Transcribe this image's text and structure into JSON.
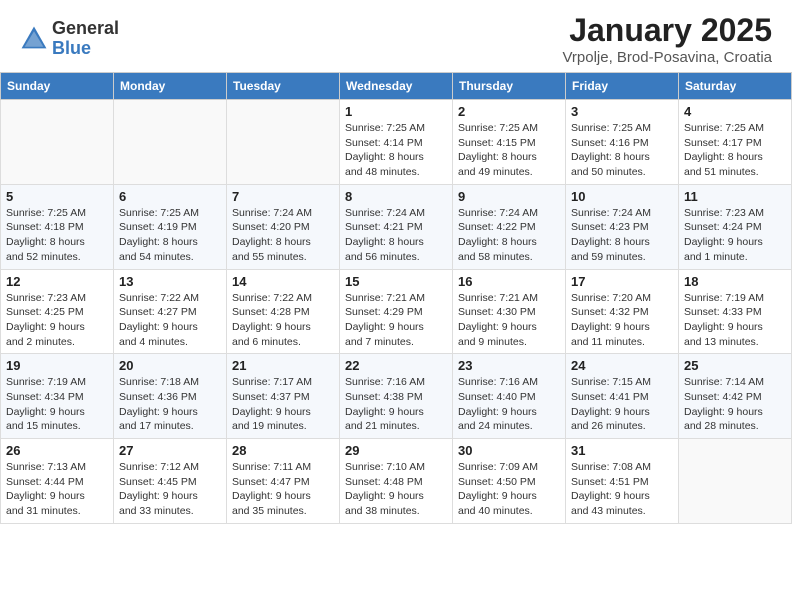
{
  "header": {
    "logo_general": "General",
    "logo_blue": "Blue",
    "month": "January 2025",
    "location": "Vrpolje, Brod-Posavina, Croatia"
  },
  "weekdays": [
    "Sunday",
    "Monday",
    "Tuesday",
    "Wednesday",
    "Thursday",
    "Friday",
    "Saturday"
  ],
  "weeks": [
    [
      {
        "day": "",
        "info": ""
      },
      {
        "day": "",
        "info": ""
      },
      {
        "day": "",
        "info": ""
      },
      {
        "day": "1",
        "info": "Sunrise: 7:25 AM\nSunset: 4:14 PM\nDaylight: 8 hours\nand 48 minutes."
      },
      {
        "day": "2",
        "info": "Sunrise: 7:25 AM\nSunset: 4:15 PM\nDaylight: 8 hours\nand 49 minutes."
      },
      {
        "day": "3",
        "info": "Sunrise: 7:25 AM\nSunset: 4:16 PM\nDaylight: 8 hours\nand 50 minutes."
      },
      {
        "day": "4",
        "info": "Sunrise: 7:25 AM\nSunset: 4:17 PM\nDaylight: 8 hours\nand 51 minutes."
      }
    ],
    [
      {
        "day": "5",
        "info": "Sunrise: 7:25 AM\nSunset: 4:18 PM\nDaylight: 8 hours\nand 52 minutes."
      },
      {
        "day": "6",
        "info": "Sunrise: 7:25 AM\nSunset: 4:19 PM\nDaylight: 8 hours\nand 54 minutes."
      },
      {
        "day": "7",
        "info": "Sunrise: 7:24 AM\nSunset: 4:20 PM\nDaylight: 8 hours\nand 55 minutes."
      },
      {
        "day": "8",
        "info": "Sunrise: 7:24 AM\nSunset: 4:21 PM\nDaylight: 8 hours\nand 56 minutes."
      },
      {
        "day": "9",
        "info": "Sunrise: 7:24 AM\nSunset: 4:22 PM\nDaylight: 8 hours\nand 58 minutes."
      },
      {
        "day": "10",
        "info": "Sunrise: 7:24 AM\nSunset: 4:23 PM\nDaylight: 8 hours\nand 59 minutes."
      },
      {
        "day": "11",
        "info": "Sunrise: 7:23 AM\nSunset: 4:24 PM\nDaylight: 9 hours\nand 1 minute."
      }
    ],
    [
      {
        "day": "12",
        "info": "Sunrise: 7:23 AM\nSunset: 4:25 PM\nDaylight: 9 hours\nand 2 minutes."
      },
      {
        "day": "13",
        "info": "Sunrise: 7:22 AM\nSunset: 4:27 PM\nDaylight: 9 hours\nand 4 minutes."
      },
      {
        "day": "14",
        "info": "Sunrise: 7:22 AM\nSunset: 4:28 PM\nDaylight: 9 hours\nand 6 minutes."
      },
      {
        "day": "15",
        "info": "Sunrise: 7:21 AM\nSunset: 4:29 PM\nDaylight: 9 hours\nand 7 minutes."
      },
      {
        "day": "16",
        "info": "Sunrise: 7:21 AM\nSunset: 4:30 PM\nDaylight: 9 hours\nand 9 minutes."
      },
      {
        "day": "17",
        "info": "Sunrise: 7:20 AM\nSunset: 4:32 PM\nDaylight: 9 hours\nand 11 minutes."
      },
      {
        "day": "18",
        "info": "Sunrise: 7:19 AM\nSunset: 4:33 PM\nDaylight: 9 hours\nand 13 minutes."
      }
    ],
    [
      {
        "day": "19",
        "info": "Sunrise: 7:19 AM\nSunset: 4:34 PM\nDaylight: 9 hours\nand 15 minutes."
      },
      {
        "day": "20",
        "info": "Sunrise: 7:18 AM\nSunset: 4:36 PM\nDaylight: 9 hours\nand 17 minutes."
      },
      {
        "day": "21",
        "info": "Sunrise: 7:17 AM\nSunset: 4:37 PM\nDaylight: 9 hours\nand 19 minutes."
      },
      {
        "day": "22",
        "info": "Sunrise: 7:16 AM\nSunset: 4:38 PM\nDaylight: 9 hours\nand 21 minutes."
      },
      {
        "day": "23",
        "info": "Sunrise: 7:16 AM\nSunset: 4:40 PM\nDaylight: 9 hours\nand 24 minutes."
      },
      {
        "day": "24",
        "info": "Sunrise: 7:15 AM\nSunset: 4:41 PM\nDaylight: 9 hours\nand 26 minutes."
      },
      {
        "day": "25",
        "info": "Sunrise: 7:14 AM\nSunset: 4:42 PM\nDaylight: 9 hours\nand 28 minutes."
      }
    ],
    [
      {
        "day": "26",
        "info": "Sunrise: 7:13 AM\nSunset: 4:44 PM\nDaylight: 9 hours\nand 31 minutes."
      },
      {
        "day": "27",
        "info": "Sunrise: 7:12 AM\nSunset: 4:45 PM\nDaylight: 9 hours\nand 33 minutes."
      },
      {
        "day": "28",
        "info": "Sunrise: 7:11 AM\nSunset: 4:47 PM\nDaylight: 9 hours\nand 35 minutes."
      },
      {
        "day": "29",
        "info": "Sunrise: 7:10 AM\nSunset: 4:48 PM\nDaylight: 9 hours\nand 38 minutes."
      },
      {
        "day": "30",
        "info": "Sunrise: 7:09 AM\nSunset: 4:50 PM\nDaylight: 9 hours\nand 40 minutes."
      },
      {
        "day": "31",
        "info": "Sunrise: 7:08 AM\nSunset: 4:51 PM\nDaylight: 9 hours\nand 43 minutes."
      },
      {
        "day": "",
        "info": ""
      }
    ]
  ]
}
